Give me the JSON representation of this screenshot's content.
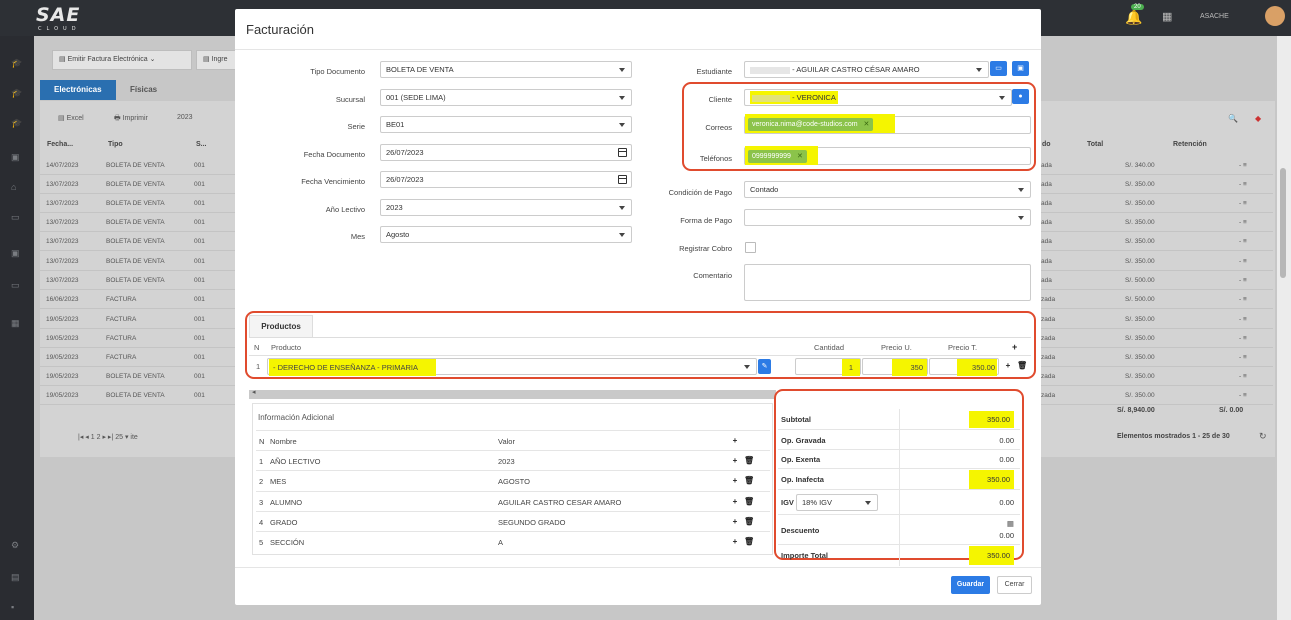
{
  "app": {
    "logo": "SAE",
    "logo_sub": "CLOUD",
    "notifications": "20",
    "user": "ASACHE"
  },
  "background": {
    "toolbar_btn1": "Emitir Factura Electrónica",
    "toolbar_btn2": "Ingre",
    "tab1": "Electrónicas",
    "tab2": "Físicas",
    "excel": "Excel",
    "print": "Imprimir",
    "year": "2023",
    "col_fecha": "Fecha...",
    "col_tipo": "Tipo",
    "col_s": "S...",
    "col_do": "do",
    "col_total": "Total",
    "col_ret": "Retención",
    "rows": [
      {
        "fecha": "14/07/2023",
        "tipo": "BOLETA DE VENTA",
        "s": "001",
        "st": "ada",
        "total": "S/. 340.00"
      },
      {
        "fecha": "13/07/2023",
        "tipo": "BOLETA DE VENTA",
        "s": "001",
        "st": "ada",
        "total": "S/. 350.00"
      },
      {
        "fecha": "13/07/2023",
        "tipo": "BOLETA DE VENTA",
        "s": "001",
        "st": "ada",
        "total": "S/. 350.00"
      },
      {
        "fecha": "13/07/2023",
        "tipo": "BOLETA DE VENTA",
        "s": "001",
        "st": "ada",
        "total": "S/. 350.00"
      },
      {
        "fecha": "13/07/2023",
        "tipo": "BOLETA DE VENTA",
        "s": "001",
        "st": "ada",
        "total": "S/. 350.00"
      },
      {
        "fecha": "13/07/2023",
        "tipo": "BOLETA DE VENTA",
        "s": "001",
        "st": "ada",
        "total": "S/. 350.00"
      },
      {
        "fecha": "13/07/2023",
        "tipo": "BOLETA DE VENTA",
        "s": "001",
        "st": "ada",
        "total": "S/. 500.00"
      },
      {
        "fecha": "16/06/2023",
        "tipo": "FACTURA",
        "s": "001",
        "st": "zada",
        "total": "S/. 500.00"
      },
      {
        "fecha": "19/05/2023",
        "tipo": "FACTURA",
        "s": "001",
        "st": "zada",
        "total": "S/. 350.00"
      },
      {
        "fecha": "19/05/2023",
        "tipo": "FACTURA",
        "s": "001",
        "st": "zada",
        "total": "S/. 350.00"
      },
      {
        "fecha": "19/05/2023",
        "tipo": "FACTURA",
        "s": "001",
        "st": "zada",
        "total": "S/. 350.00"
      },
      {
        "fecha": "19/05/2023",
        "tipo": "BOLETA DE VENTA",
        "s": "001",
        "st": "zada",
        "total": "S/. 350.00"
      },
      {
        "fecha": "19/05/2023",
        "tipo": "BOLETA DE VENTA",
        "s": "001",
        "st": "zada",
        "total": "S/. 350.00"
      }
    ],
    "sum_total": "S/. 8,940.00",
    "sum_ret": "S/. 0.00",
    "pager_page1": "1",
    "pager_page2": "2",
    "pager_size": "25",
    "pager_items": "ite",
    "shown": "Elementos mostrados 1 - 25 de 30"
  },
  "modal": {
    "title": "Facturación",
    "left": {
      "tipo_documento": {
        "label": "Tipo Documento",
        "value": "BOLETA DE VENTA"
      },
      "sucursal": {
        "label": "Sucursal",
        "value": "001 (SEDE LIMA)"
      },
      "serie": {
        "label": "Serie",
        "value": "BE01"
      },
      "fecha_documento": {
        "label": "Fecha Documento",
        "value": "26/07/2023"
      },
      "fecha_vencimiento": {
        "label": "Fecha Vencimiento",
        "value": "26/07/2023"
      },
      "anio_lectivo": {
        "label": "Año Lectivo",
        "value": "2023"
      },
      "mes": {
        "label": "Mes",
        "value": "Agosto"
      }
    },
    "right": {
      "estudiante": {
        "label": "Estudiante",
        "value": "- AGUILAR CASTRO CÉSAR AMARO"
      },
      "cliente": {
        "label": "Cliente",
        "value": "- VERONICA"
      },
      "correos": {
        "label": "Correos",
        "value": "veronica.nima@code-studios.com"
      },
      "telefonos": {
        "label": "Teléfonos",
        "value": "0999999999"
      },
      "condicion_pago": {
        "label": "Condición de Pago",
        "value": "Contado"
      },
      "forma_pago": {
        "label": "Forma de Pago",
        "value": ""
      },
      "registrar_cobro": {
        "label": "Registrar Cobro"
      },
      "comentario": {
        "label": "Comentario",
        "value": ""
      }
    },
    "productos": {
      "tab": "Productos",
      "headers": {
        "n": "N",
        "producto": "Producto",
        "cantidad": "Cantidad",
        "precio_u": "Precio U.",
        "precio_t": "Precio T.",
        "add": "+"
      },
      "rows": [
        {
          "n": "1",
          "producto": "- DERECHO DE ENSEÑANZA - PRIMARIA",
          "cantidad": "1",
          "precio_u": "350",
          "precio_t": "350.00"
        }
      ]
    },
    "info": {
      "title": "Información Adicional",
      "headers": {
        "n": "N",
        "nombre": "Nombre",
        "valor": "Valor"
      },
      "rows": [
        {
          "n": "1",
          "nombre": "AÑO LECTIVO",
          "valor": "2023"
        },
        {
          "n": "2",
          "nombre": "MES",
          "valor": "AGOSTO"
        },
        {
          "n": "3",
          "nombre": "ALUMNO",
          "valor": "AGUILAR CASTRO CESAR AMARO"
        },
        {
          "n": "4",
          "nombre": "GRADO",
          "valor": "SEGUNDO GRADO"
        },
        {
          "n": "5",
          "nombre": "SECCIÓN",
          "valor": "A"
        }
      ]
    },
    "totals": {
      "subtotal": {
        "label": "Subtotal",
        "value": "350.00"
      },
      "gravada": {
        "label": "Op. Gravada",
        "value": "0.00"
      },
      "exenta": {
        "label": "Op. Exenta",
        "value": "0.00"
      },
      "inafecta": {
        "label": "Op. Inafecta",
        "value": "350.00"
      },
      "igv": {
        "label": "IGV",
        "select": "18% IGV",
        "value": "0.00"
      },
      "descuento": {
        "label": "Descuento",
        "value": "0.00"
      },
      "importe": {
        "label": "Importe Total",
        "value": "350.00"
      }
    },
    "buttons": {
      "guardar": "Guardar",
      "cerrar": "Cerrar"
    }
  },
  "colors": {
    "accent": "#2c7be5",
    "highlight": "#f5f500",
    "annotation": "#e04b2e",
    "chip": "#8bc34a"
  }
}
